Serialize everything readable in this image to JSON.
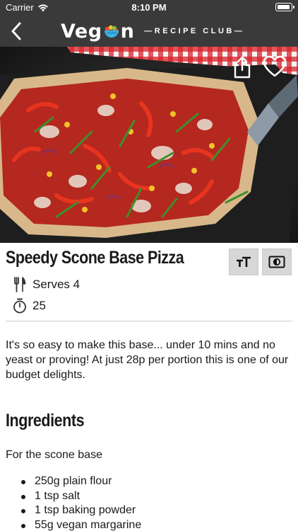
{
  "status_bar": {
    "carrier": "Carrier",
    "time": "8:10 PM"
  },
  "nav": {
    "back_icon": "chevron-left-icon",
    "logo_word_left": "Veg",
    "logo_word_right": "n",
    "logo_tagline": "—RECIPE CLUB—"
  },
  "hero": {
    "share_icon": "share-icon",
    "favorite_icon": "heart-icon"
  },
  "recipe": {
    "title": "Speedy Scone Base Pizza",
    "serves": "Serves 4",
    "time": "25",
    "description": "It's so easy to make this base... under 10 mins and no yeast or proving! At just 28p per portion this is one of our budget delights."
  },
  "ingredients": {
    "heading": "Ingredients",
    "subheading": "For the scone base",
    "items": [
      "250g plain flour",
      "1 tsp salt",
      "1 tsp baking powder",
      "55g vegan margarine"
    ]
  },
  "colors": {
    "header_bg": "#3a3a3a",
    "tool_button_bg": "#d7d7d7",
    "text": "#1a1a1a"
  }
}
